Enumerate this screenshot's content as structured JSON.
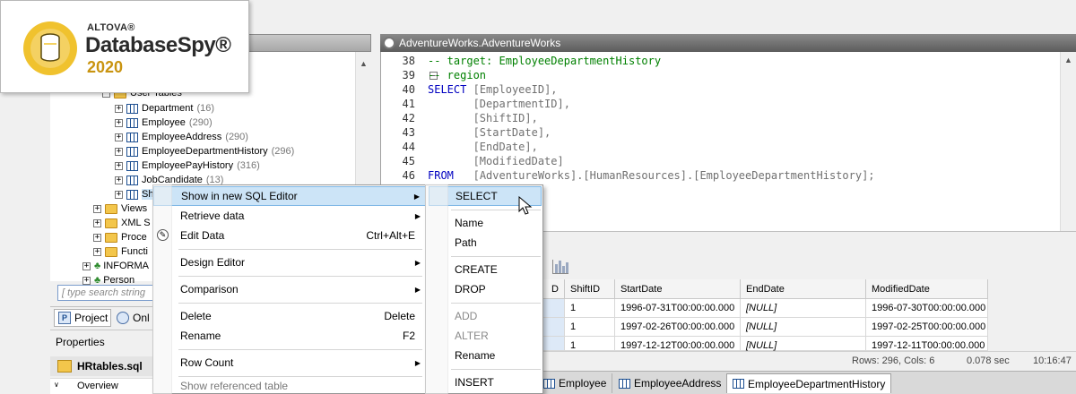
{
  "logo": {
    "brand": "ALTOVA®",
    "product": "DatabaseSpy®",
    "year": "2020"
  },
  "colors": {
    "accent_gold": "#f0c22e",
    "highlight": "#cce4f7",
    "comment": "#008000",
    "keyword": "#0000c0"
  },
  "tree": {
    "folder_user_tables": "User Tables",
    "tables": [
      {
        "name": "Department",
        "count": "(16)"
      },
      {
        "name": "Employee",
        "count": "(290)"
      },
      {
        "name": "EmployeeAddress",
        "count": "(290)"
      },
      {
        "name": "EmployeeDepartmentHistory",
        "count": "(296)"
      },
      {
        "name": "EmployeePayHistory",
        "count": "(316)"
      },
      {
        "name": "JobCandidate",
        "count": "(13)"
      },
      {
        "name": "Sh",
        "count": ""
      }
    ],
    "folders": [
      "Views",
      "XML S",
      "Proce",
      "Functi"
    ],
    "schemas": [
      "INFORMA",
      "Person"
    ],
    "search_placeholder": "[ type search string"
  },
  "left_tabs": {
    "project": "Project",
    "online": "Onl"
  },
  "properties": {
    "title": "Properties",
    "file": "HRtables.sql",
    "overview": "Overview"
  },
  "editor": {
    "title": "AdventureWorks.AdventureWorks",
    "lines": [
      {
        "num": "38",
        "comment": "-- target: EmployeeDepartmentHistory"
      },
      {
        "num": "39",
        "comment": "-- region"
      },
      {
        "num": "40",
        "kw": "SELECT",
        "id": "[EmployeeID],"
      },
      {
        "num": "41",
        "id": "[DepartmentID],"
      },
      {
        "num": "42",
        "id": "[ShiftID],"
      },
      {
        "num": "43",
        "id": "[StartDate],"
      },
      {
        "num": "44",
        "id": "[EndDate],"
      },
      {
        "num": "45",
        "id": "[ModifiedDate]"
      },
      {
        "num": "46",
        "kw": "FROM",
        "id": "[AdventureWorks].[HumanResources].[EmployeeDepartmentHistory];"
      }
    ]
  },
  "context_menu": {
    "items": [
      {
        "label": "Show in new SQL Editor",
        "shortcut": ""
      },
      {
        "label": "Retrieve data",
        "shortcut": ""
      },
      {
        "label": "Edit Data",
        "shortcut": "Ctrl+Alt+E"
      },
      {
        "label": "Design Editor",
        "shortcut": ""
      },
      {
        "label": "Comparison",
        "shortcut": ""
      },
      {
        "label": "Delete",
        "shortcut": "Delete"
      },
      {
        "label": "Rename",
        "shortcut": "F2"
      },
      {
        "label": "Row Count",
        "shortcut": ""
      },
      {
        "label": "Show referenced table",
        "shortcut": ""
      }
    ]
  },
  "submenu": {
    "items": [
      "SELECT",
      "Name",
      "Path",
      "CREATE",
      "DROP",
      "ADD",
      "ALTER",
      "Rename",
      "INSERT"
    ]
  },
  "results": {
    "headers": [
      "D",
      "ShiftID",
      "StartDate",
      "EndDate",
      "ModifiedDate"
    ],
    "rows": [
      [
        "",
        "1",
        "1996-07-31T00:00:00.000",
        "[NULL]",
        "1996-07-30T00:00:00.000"
      ],
      [
        "",
        "1",
        "1997-02-26T00:00:00.000",
        "[NULL]",
        "1997-02-25T00:00:00.000"
      ],
      [
        "",
        "1",
        "1997-12-12T00:00:00.000",
        "[NULL]",
        "1997-12-11T00:00:00.000"
      ]
    ]
  },
  "status": {
    "rows": "Rows: 296, Cols: 6",
    "time": "0.078 sec",
    "clock": "10:16:47"
  },
  "doc_tabs": [
    "Employee",
    "EmployeeAddress",
    "EmployeeDepartmentHistory"
  ]
}
